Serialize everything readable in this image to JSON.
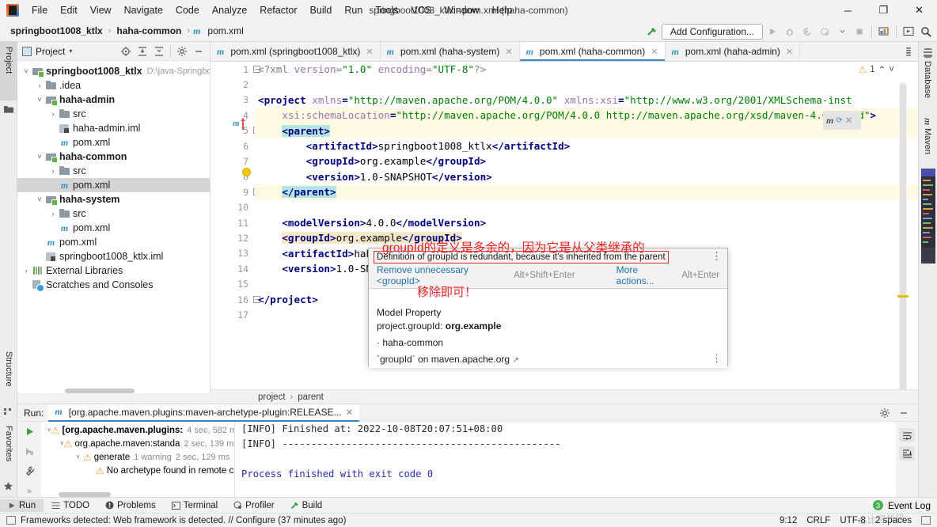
{
  "window": {
    "title": "springboot1008_ktlx - pom.xml (haha-common)",
    "minimize": "─",
    "maximize": "❐",
    "close": "✕"
  },
  "menu": {
    "items": [
      "File",
      "Edit",
      "View",
      "Navigate",
      "Code",
      "Analyze",
      "Refactor",
      "Build",
      "Run",
      "Tools",
      "VCS",
      "Window",
      "Help"
    ]
  },
  "navbar": {
    "breadcrumbs": [
      {
        "label": "springboot1008_ktlx",
        "bold": true,
        "icon": null
      },
      {
        "label": "haha-common",
        "bold": true,
        "icon": null
      },
      {
        "label": "pom.xml",
        "bold": false,
        "icon": "maven-m-icon"
      }
    ],
    "separator": "›",
    "add_configuration": "Add Configuration...",
    "icons": [
      "build-hammer-icon",
      "run-icon",
      "debug-icon",
      "run-coverage-icon",
      "profile-icon",
      "dropdown-icon",
      "stop-icon",
      "project-structure-icon",
      "select-in-icon",
      "search-icon"
    ]
  },
  "left_toolwindows": [
    {
      "label": "Project",
      "active": true,
      "icon": "project-folder-icon"
    },
    {
      "label": "Structure",
      "active": false,
      "icon": "structure-icon"
    },
    {
      "label": "Favorites",
      "active": false,
      "icon": "star-icon"
    }
  ],
  "right_toolwindows": [
    {
      "label": "Database",
      "icon": "database-icon"
    },
    {
      "label": "Maven",
      "icon": "maven-m-icon"
    }
  ],
  "project_panel": {
    "title": "Project",
    "caret": "▾",
    "tools": [
      "locate-icon",
      "expand-all-icon",
      "collapse-all-icon",
      "settings-gear-icon",
      "hide-icon"
    ],
    "tree": [
      {
        "depth": 0,
        "arrow": "˅",
        "icon": "module-icon",
        "label": "springboot1008_ktlx",
        "bold": true,
        "path": "D:\\java-Springbo",
        "selected": false
      },
      {
        "depth": 1,
        "arrow": "›",
        "icon": "folder-icon",
        "label": ".idea",
        "bold": false,
        "path": "",
        "selected": false
      },
      {
        "depth": 1,
        "arrow": "˅",
        "icon": "module-icon",
        "label": "haha-admin",
        "bold": true,
        "path": "",
        "selected": false
      },
      {
        "depth": 2,
        "arrow": "›",
        "icon": "folder-icon",
        "label": "src",
        "bold": false,
        "path": "",
        "selected": false
      },
      {
        "depth": 2,
        "arrow": "",
        "icon": "iml-icon",
        "label": "haha-admin.iml",
        "bold": false,
        "path": "",
        "selected": false
      },
      {
        "depth": 2,
        "arrow": "",
        "icon": "maven-m-icon",
        "label": "pom.xml",
        "bold": false,
        "path": "",
        "selected": false
      },
      {
        "depth": 1,
        "arrow": "˅",
        "icon": "module-icon",
        "label": "haha-common",
        "bold": true,
        "path": "",
        "selected": false
      },
      {
        "depth": 2,
        "arrow": "›",
        "icon": "folder-icon",
        "label": "src",
        "bold": false,
        "path": "",
        "selected": false
      },
      {
        "depth": 2,
        "arrow": "",
        "icon": "maven-m-icon",
        "label": "pom.xml",
        "bold": false,
        "path": "",
        "selected": true
      },
      {
        "depth": 1,
        "arrow": "˅",
        "icon": "module-icon",
        "label": "haha-system",
        "bold": true,
        "path": "",
        "selected": false
      },
      {
        "depth": 2,
        "arrow": "›",
        "icon": "folder-icon",
        "label": "src",
        "bold": false,
        "path": "",
        "selected": false
      },
      {
        "depth": 2,
        "arrow": "",
        "icon": "maven-m-icon",
        "label": "pom.xml",
        "bold": false,
        "path": "",
        "selected": false
      },
      {
        "depth": 1,
        "arrow": "",
        "icon": "maven-m-icon",
        "label": "pom.xml",
        "bold": false,
        "path": "",
        "selected": false
      },
      {
        "depth": 1,
        "arrow": "",
        "icon": "iml-icon",
        "label": "springboot1008_ktlx.iml",
        "bold": false,
        "path": "",
        "selected": false
      },
      {
        "depth": 0,
        "arrow": "›",
        "icon": "external-libraries-icon",
        "label": "External Libraries",
        "bold": false,
        "path": "",
        "selected": false
      },
      {
        "depth": 0,
        "arrow": "",
        "icon": "scratches-icon",
        "label": "Scratches and Consoles",
        "bold": false,
        "path": "",
        "selected": false
      }
    ]
  },
  "editor": {
    "tabs": [
      {
        "label": "pom.xml (springboot1008_ktlx)",
        "active": false,
        "icon": "maven-m-icon",
        "close": "✕"
      },
      {
        "label": "pom.xml (haha-system)",
        "active": false,
        "icon": "maven-m-icon",
        "close": "✕"
      },
      {
        "label": "pom.xml (haha-common)",
        "active": true,
        "icon": "maven-m-icon",
        "close": "✕"
      },
      {
        "label": "pom.xml (haha-admin)",
        "active": false,
        "icon": "maven-m-icon",
        "close": "✕"
      }
    ],
    "inspection": {
      "warning_count": "1",
      "up": "⌃",
      "down": "˅",
      "icon": "warning-triangle-icon"
    },
    "maven_float": {
      "m": "m",
      "reload": "⟳",
      "close": "✕"
    },
    "line_numbers": [
      "1",
      "2",
      "3",
      "4",
      "5",
      "6",
      "7",
      "8",
      "9",
      "10",
      "11",
      "12",
      "13",
      "14",
      "15",
      "16",
      "17"
    ],
    "lines": [
      {
        "n": 1,
        "html": "<span class=\"pi\">&lt;?xml </span><span class=\"at\">version</span><span class=\"pi\">=</span><span class=\"st\">\"1.0\"</span><span class=\"at\"> encoding</span><span class=\"pi\">=</span><span class=\"st\">\"UTF-8\"</span><span class=\"pi\">?&gt;</span>",
        "hl": false
      },
      {
        "n": 2,
        "html": "",
        "hl": false
      },
      {
        "n": 3,
        "html": "<span class=\"tg\">&lt;project </span><span class=\"at\">xmlns</span><span class=\"tg\">=</span><span class=\"st\">\"http://maven.apache.org/POM/4.0.0\"</span><span class=\"at\"> xmlns:xsi</span><span class=\"tg\">=</span><span class=\"st\">\"http://www.w3.org/2001/XMLSchema-inst</span>",
        "hl": false
      },
      {
        "n": 4,
        "html": "    <span class=\"at\">xsi:schemaLocation</span><span class=\"tg\">=</span><span class=\"st\">\"http://maven.apache.org/POM/4.0.0 http://maven.apache.org/xsd/maven-4.0.0.xsd\"</span><span class=\"tg\">&gt;</span>",
        "hl": true
      },
      {
        "n": 5,
        "html": "    <span class=\"sel-tok tg\">&lt;parent&gt;</span>",
        "hl": true
      },
      {
        "n": 6,
        "html": "        <span class=\"tg\">&lt;artifactId&gt;</span><span class=\"txt\">springboot1008_ktlx</span><span class=\"tg\">&lt;/artifactId&gt;</span>",
        "hl": false
      },
      {
        "n": 7,
        "html": "        <span class=\"tg\">&lt;groupId&gt;</span><span class=\"txt\">org.example</span><span class=\"tg\">&lt;/groupId&gt;</span>",
        "hl": false
      },
      {
        "n": 8,
        "html": "        <span class=\"tg\">&lt;version&gt;</span><span class=\"txt\">1.0-SNAPSHOT</span><span class=\"tg\">&lt;/version&gt;</span>",
        "hl": false
      },
      {
        "n": 9,
        "html": "    <span class=\"sel-tok tg\">&lt;/parent&gt;</span>",
        "hl": true
      },
      {
        "n": 10,
        "html": "",
        "hl": false
      },
      {
        "n": 11,
        "html": "    <span class=\"tg\">&lt;modelVersion&gt;</span><span class=\"txt\">4.0.0</span><span class=\"tg\">&lt;/modelVersion&gt;</span>",
        "hl": false
      },
      {
        "n": 12,
        "html": "    <span class=\"warn-tok\"><span class=\"tg\">&lt;groupId&gt;</span><span class=\"txt\">org.example</span><span class=\"tg\">&lt;/groupId&gt;</span></span>",
        "hl": false
      },
      {
        "n": 13,
        "html": "    <span class=\"tg\">&lt;artifactId&gt;</span><span class=\"txt\">haha-</span>",
        "hl": false
      },
      {
        "n": 14,
        "html": "    <span class=\"tg\">&lt;version&gt;</span><span class=\"txt\">1.0-SNAP</span>",
        "hl": false
      },
      {
        "n": 15,
        "html": "",
        "hl": false
      },
      {
        "n": 16,
        "html": "<span class=\"tg\">&lt;/project&gt;</span>",
        "hl": false
      },
      {
        "n": 17,
        "html": "",
        "hl": false
      }
    ],
    "breadcrumbs": [
      "project",
      "parent"
    ],
    "breadcrumb_sep": "›"
  },
  "popup": {
    "message": "Definition of groupId is redundant, because it's inherited from the parent",
    "actions": [
      {
        "label": "Remove unnecessary <groupId>",
        "shortcut": "Alt+Shift+Enter"
      },
      {
        "label": "More actions...",
        "shortcut": "Alt+Enter"
      }
    ],
    "menu_dots": "⋮",
    "body": {
      "heading": "Model Property",
      "property_label": "project.groupId:",
      "property_value": "org.example",
      "bullet": "· haha-common",
      "link": "`groupId` on maven.apache.org",
      "external_arrow": "↗"
    }
  },
  "annotations": [
    {
      "id": "annot1",
      "text": "groupId的定义是多余的，因为它是从父类继承的"
    },
    {
      "id": "annot2",
      "text": "移除即可！"
    }
  ],
  "run_panel": {
    "label": "Run:",
    "tab_title": "[org.apache.maven.plugins:maven-archetype-plugin:RELEASE...",
    "tab_close": "✕",
    "header_icons": [
      "settings-gear-icon",
      "hide-icon"
    ],
    "side_icons": [
      "rerun-icon",
      "rerun-failed-icon",
      "settings-wrench-icon",
      "expand-more-icon"
    ],
    "right_icons": [
      "soft-wrap-icon",
      "scroll-to-end-icon"
    ],
    "tree": [
      {
        "depth": 0,
        "arrow": "˅",
        "label": "[org.apache.maven.plugins:",
        "bold": true,
        "time": "4 sec, 582 ms",
        "extra": ""
      },
      {
        "depth": 1,
        "arrow": "˅",
        "label": "org.apache.maven:standa",
        "bold": false,
        "time": "2 sec, 139 ms",
        "extra": ""
      },
      {
        "depth": 2,
        "arrow": "˅",
        "label": "generate",
        "bold": false,
        "time": "2 sec, 129 ms",
        "extra": "1 warning"
      },
      {
        "depth": 3,
        "arrow": "",
        "label": "No archetype found in remote c",
        "bold": false,
        "time": "",
        "extra": ""
      }
    ],
    "console": [
      {
        "text": "[INFO] Finished at: 2022-10-08T20:07:51+08:00",
        "color": "dark"
      },
      {
        "text": "[INFO] ------------------------------------------------",
        "color": "dark"
      },
      {
        "text": "",
        "color": "dark"
      },
      {
        "text": "Process finished with exit code 0",
        "color": "blue"
      }
    ]
  },
  "bottom_bar": {
    "items": [
      {
        "label": "Run",
        "icon": "run-play-icon",
        "active": true
      },
      {
        "label": "TODO",
        "icon": "todo-list-icon",
        "active": false
      },
      {
        "label": "Problems",
        "icon": "problems-icon",
        "active": false
      },
      {
        "label": "Terminal",
        "icon": "terminal-icon",
        "active": false
      },
      {
        "label": "Profiler",
        "icon": "profiler-icon",
        "active": false
      },
      {
        "label": "Build",
        "icon": "build-hammer-icon",
        "active": false
      }
    ],
    "event_log": {
      "label": "Event Log",
      "count": "3"
    }
  },
  "status_bar": {
    "message": "Frameworks detected: Web framework is detected. // Configure (37 minutes ago)",
    "message_icon": "notification-icon",
    "caret_position": "9:12",
    "line_separator": "CRLF",
    "encoding": "UTF-8",
    "indent": "2 spaces",
    "lock_icon": "write-access-icon"
  }
}
